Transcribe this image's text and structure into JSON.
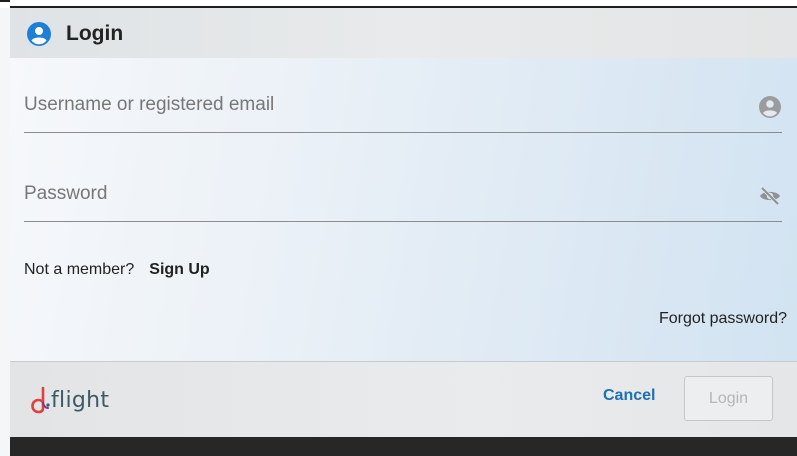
{
  "header": {
    "title": "Login"
  },
  "form": {
    "username": {
      "placeholder": "Username or registered email",
      "value": ""
    },
    "password": {
      "placeholder": "Password",
      "value": ""
    },
    "member_prompt": "Not a member?",
    "signup_label": "Sign Up",
    "forgot_label": "Forgot password?"
  },
  "footer": {
    "logo_text": "flight",
    "cancel_label": "Cancel",
    "login_label": "Login"
  },
  "icons": {
    "header": "account-circle-icon",
    "username": "account-circle-icon",
    "password": "eye-off-icon"
  },
  "colors": {
    "accent": "#1e6fb3",
    "logo_red": "#e0403f",
    "logo_text": "#3d5a68",
    "disabled_text": "#b4b6b8"
  }
}
